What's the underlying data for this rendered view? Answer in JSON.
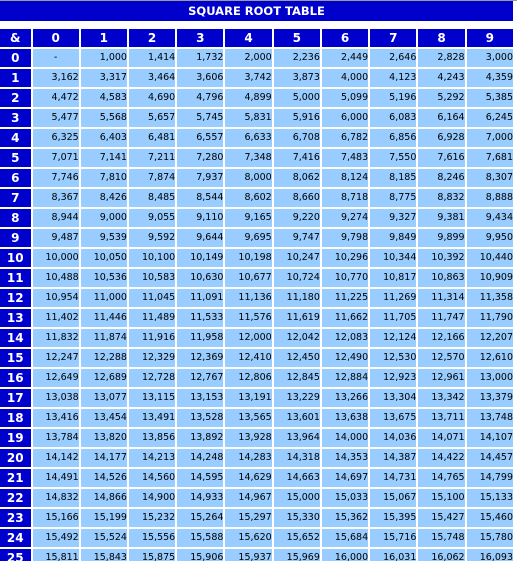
{
  "title": "SQUARE ROOT TABLE",
  "colors": {
    "header_bg": "#0000CC",
    "header_text": "#FFFFFF",
    "cell_bg": "#99CCFF",
    "cell_text": "#000000",
    "grid_line": "#FFFFFF"
  },
  "table": {
    "corner_label": "&",
    "column_headers": [
      "0",
      "1",
      "2",
      "3",
      "4",
      "5",
      "6",
      "7",
      "8",
      "9"
    ],
    "rows": [
      {
        "label": "0",
        "values": [
          "-",
          "1,000",
          "1,414",
          "1,732",
          "2,000",
          "2,236",
          "2,449",
          "2,646",
          "2,828",
          "3,000"
        ]
      },
      {
        "label": "1",
        "values": [
          "3,162",
          "3,317",
          "3,464",
          "3,606",
          "3,742",
          "3,873",
          "4,000",
          "4,123",
          "4,243",
          "4,359"
        ]
      },
      {
        "label": "2",
        "values": [
          "4,472",
          "4,583",
          "4,690",
          "4,796",
          "4,899",
          "5,000",
          "5,099",
          "5,196",
          "5,292",
          "5,385"
        ]
      },
      {
        "label": "3",
        "values": [
          "5,477",
          "5,568",
          "5,657",
          "5,745",
          "5,831",
          "5,916",
          "6,000",
          "6,083",
          "6,164",
          "6,245"
        ]
      },
      {
        "label": "4",
        "values": [
          "6,325",
          "6,403",
          "6,481",
          "6,557",
          "6,633",
          "6,708",
          "6,782",
          "6,856",
          "6,928",
          "7,000"
        ]
      },
      {
        "label": "5",
        "values": [
          "7,071",
          "7,141",
          "7,211",
          "7,280",
          "7,348",
          "7,416",
          "7,483",
          "7,550",
          "7,616",
          "7,681"
        ]
      },
      {
        "label": "6",
        "values": [
          "7,746",
          "7,810",
          "7,874",
          "7,937",
          "8,000",
          "8,062",
          "8,124",
          "8,185",
          "8,246",
          "8,307"
        ]
      },
      {
        "label": "7",
        "values": [
          "8,367",
          "8,426",
          "8,485",
          "8,544",
          "8,602",
          "8,660",
          "8,718",
          "8,775",
          "8,832",
          "8,888"
        ]
      },
      {
        "label": "8",
        "values": [
          "8,944",
          "9,000",
          "9,055",
          "9,110",
          "9,165",
          "9,220",
          "9,274",
          "9,327",
          "9,381",
          "9,434"
        ]
      },
      {
        "label": "9",
        "values": [
          "9,487",
          "9,539",
          "9,592",
          "9,644",
          "9,695",
          "9,747",
          "9,798",
          "9,849",
          "9,899",
          "9,950"
        ]
      },
      {
        "label": "10",
        "values": [
          "10,000",
          "10,050",
          "10,100",
          "10,149",
          "10,198",
          "10,247",
          "10,296",
          "10,344",
          "10,392",
          "10,440"
        ]
      },
      {
        "label": "11",
        "values": [
          "10,488",
          "10,536",
          "10,583",
          "10,630",
          "10,677",
          "10,724",
          "10,770",
          "10,817",
          "10,863",
          "10,909"
        ]
      },
      {
        "label": "12",
        "values": [
          "10,954",
          "11,000",
          "11,045",
          "11,091",
          "11,136",
          "11,180",
          "11,225",
          "11,269",
          "11,314",
          "11,358"
        ]
      },
      {
        "label": "13",
        "values": [
          "11,402",
          "11,446",
          "11,489",
          "11,533",
          "11,576",
          "11,619",
          "11,662",
          "11,705",
          "11,747",
          "11,790"
        ]
      },
      {
        "label": "14",
        "values": [
          "11,832",
          "11,874",
          "11,916",
          "11,958",
          "12,000",
          "12,042",
          "12,083",
          "12,124",
          "12,166",
          "12,207"
        ]
      },
      {
        "label": "15",
        "values": [
          "12,247",
          "12,288",
          "12,329",
          "12,369",
          "12,410",
          "12,450",
          "12,490",
          "12,530",
          "12,570",
          "12,610"
        ]
      },
      {
        "label": "16",
        "values": [
          "12,649",
          "12,689",
          "12,728",
          "12,767",
          "12,806",
          "12,845",
          "12,884",
          "12,923",
          "12,961",
          "13,000"
        ]
      },
      {
        "label": "17",
        "values": [
          "13,038",
          "13,077",
          "13,115",
          "13,153",
          "13,191",
          "13,229",
          "13,266",
          "13,304",
          "13,342",
          "13,379"
        ]
      },
      {
        "label": "18",
        "values": [
          "13,416",
          "13,454",
          "13,491",
          "13,528",
          "13,565",
          "13,601",
          "13,638",
          "13,675",
          "13,711",
          "13,748"
        ]
      },
      {
        "label": "19",
        "values": [
          "13,784",
          "13,820",
          "13,856",
          "13,892",
          "13,928",
          "13,964",
          "14,000",
          "14,036",
          "14,071",
          "14,107"
        ]
      },
      {
        "label": "20",
        "values": [
          "14,142",
          "14,177",
          "14,213",
          "14,248",
          "14,283",
          "14,318",
          "14,353",
          "14,387",
          "14,422",
          "14,457"
        ]
      },
      {
        "label": "21",
        "values": [
          "14,491",
          "14,526",
          "14,560",
          "14,595",
          "14,629",
          "14,663",
          "14,697",
          "14,731",
          "14,765",
          "14,799"
        ]
      },
      {
        "label": "22",
        "values": [
          "14,832",
          "14,866",
          "14,900",
          "14,933",
          "14,967",
          "15,000",
          "15,033",
          "15,067",
          "15,100",
          "15,133"
        ]
      },
      {
        "label": "23",
        "values": [
          "15,166",
          "15,199",
          "15,232",
          "15,264",
          "15,297",
          "15,330",
          "15,362",
          "15,395",
          "15,427",
          "15,460"
        ]
      },
      {
        "label": "24",
        "values": [
          "15,492",
          "15,524",
          "15,556",
          "15,588",
          "15,620",
          "15,652",
          "15,684",
          "15,716",
          "15,748",
          "15,780"
        ]
      },
      {
        "label": "25",
        "values": [
          "15,811",
          "15,843",
          "15,875",
          "15,906",
          "15,937",
          "15,969",
          "16,000",
          "16,031",
          "16,062",
          "16,093"
        ]
      }
    ]
  }
}
